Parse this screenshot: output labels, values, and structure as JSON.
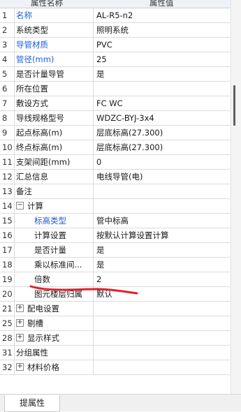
{
  "header": {
    "col_name": "属性名称",
    "col_value": "属性值"
  },
  "rows": [
    {
      "n": "1",
      "name": "名称",
      "value": "AL-R5-n2",
      "blue": true
    },
    {
      "n": "2",
      "name": "系统类型",
      "value": "照明系统"
    },
    {
      "n": "3",
      "name": "导管材质",
      "value": "PVC",
      "blue": true
    },
    {
      "n": "4",
      "name": "管径(mm)",
      "value": "25",
      "blue": true
    },
    {
      "n": "5",
      "name": "是否计量导管",
      "value": "是"
    },
    {
      "n": "6",
      "name": "所在位置",
      "value": ""
    },
    {
      "n": "7",
      "name": "敷设方式",
      "value": "FC WC"
    },
    {
      "n": "8",
      "name": "导线规格型号",
      "value": "WDZC-BYJ-3x4"
    },
    {
      "n": "9",
      "name": "起点标高(m)",
      "value": "层底标高(27.300)"
    },
    {
      "n": "10",
      "name": "终点标高(m)",
      "value": "层底标高(27.300)"
    },
    {
      "n": "11",
      "name": "支架间距(mm)",
      "value": "0"
    },
    {
      "n": "12",
      "name": "汇总信息",
      "value": "电线导管(电)"
    },
    {
      "n": "13",
      "name": "备注",
      "value": ""
    },
    {
      "n": "14",
      "name": "计算",
      "value": "",
      "expander": "−"
    },
    {
      "n": "15",
      "name": "标高类型",
      "value": "管中标高",
      "blue": true,
      "child": true
    },
    {
      "n": "16",
      "name": "计算设置",
      "value": "按默认计算设置计算",
      "child": true
    },
    {
      "n": "17",
      "name": "是否计量",
      "value": "是",
      "child": true
    },
    {
      "n": "18",
      "name": "乘以标准间...",
      "value": "是",
      "child": true
    },
    {
      "n": "19",
      "name": "倍数",
      "value": "2",
      "child": true
    },
    {
      "n": "20",
      "name": "图元楼层归属",
      "value": "默认",
      "child": true
    },
    {
      "n": "21",
      "name": "配电设置",
      "value": "",
      "expander": "+"
    },
    {
      "n": "25",
      "name": "剔槽",
      "value": "",
      "expander": "+"
    },
    {
      "n": "28",
      "name": "显示样式",
      "value": "",
      "expander": "+"
    },
    {
      "n": "31",
      "name": "分组属性",
      "value": ""
    },
    {
      "n": "32",
      "name": "材料价格",
      "value": "",
      "expander": "+"
    }
  ],
  "footer": {
    "tab_label": "提属性"
  },
  "colors": {
    "accent_blue": "#1d5fd8",
    "annotation_red": "#e3202a"
  },
  "icons": {
    "expand": "plus-box-icon",
    "collapse": "minus-box-icon"
  }
}
